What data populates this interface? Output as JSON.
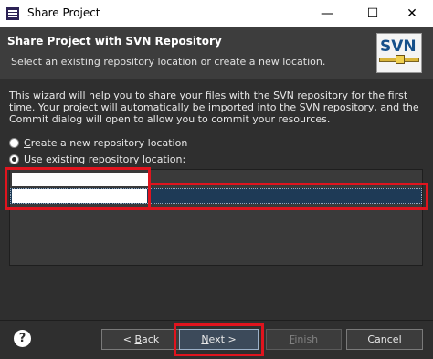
{
  "window": {
    "title": "Share Project",
    "minimize_label": "—",
    "maximize_label": "☐",
    "close_label": "✕"
  },
  "header": {
    "title": "Share Project with SVN Repository",
    "subtitle": "Select an existing repository location or create a new location.",
    "logo_text": "SVN"
  },
  "description": "This wizard will help you to share your files with the SVN repository for the first time. Your project will automatically be imported into the SVN repository, and the Commit dialog will open to allow you to commit your resources.",
  "options": {
    "create_new": {
      "prefix": "",
      "mnemonic": "C",
      "rest": "reate a new repository location",
      "checked": false
    },
    "use_existing": {
      "prefix": "Use ",
      "mnemonic": "e",
      "rest": "xisting repository location:",
      "checked": true
    }
  },
  "buttons": {
    "help": "?",
    "back_prefix": "< ",
    "back_mnemonic": "B",
    "back_rest": "ack",
    "next_mnemonic": "N",
    "next_rest": "ext >",
    "finish_mnemonic": "F",
    "finish_rest": "inish",
    "cancel": "Cancel"
  },
  "colors": {
    "highlight": "#e0141e",
    "selected_row": "#1e3a56",
    "background": "#2f2f2f"
  }
}
